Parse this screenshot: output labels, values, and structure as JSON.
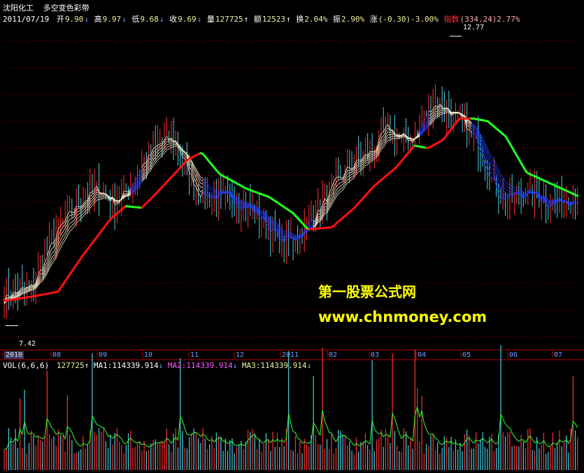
{
  "header": {
    "stock_name": "沈阳化工",
    "indicator_name": "多空变色彩带",
    "date": "2011/07/19",
    "open_label": "开",
    "open": "9.90",
    "high_label": "高",
    "high": "9.97",
    "low_label": "低",
    "low": "9.68",
    "close_label": "收",
    "close": "9.69",
    "volume_label": "量",
    "volume": "127725",
    "amount_label": "额",
    "amount": "12523",
    "turnover_label": "换",
    "turnover": "2.04%",
    "amplitude_label": "振",
    "amplitude": "2.90%",
    "change_label": "涨",
    "change": "(-0.30)-3.00%",
    "index_label": "指数",
    "index_value": "(334.24)2.77%"
  },
  "volume_panel": {
    "title": "VOL(6,6,6)",
    "volume": "127725",
    "ma1_label": "MA1:",
    "ma1": "114339.914",
    "ma2_label": "MA2:",
    "ma2": "114339.914",
    "ma3_label": "MA3:",
    "ma3": "114339.914"
  },
  "watermark": {
    "line1": "第一股票公式网",
    "line2": "www.chnmoney.com"
  },
  "colors": {
    "up": "#ff3030",
    "down": "#46d2e6",
    "bull_ribbon": "#ffffff",
    "bear_ribbon": "#1e3cff",
    "ma_up": "#ff1010",
    "ma_down": "#20ff20",
    "vol_ma": "#30ff30",
    "grid": "#8a0000"
  },
  "chart_data": [
    {
      "type": "candlestick-ribbon",
      "y_range": [
        7.0,
        13.0
      ],
      "x_tick_labels": [
        "2010",
        "08",
        "09",
        "10",
        "11",
        "12",
        "2011",
        "02",
        "03",
        "04",
        "05",
        "06",
        "07"
      ],
      "annotations": [
        {
          "text": "12.77",
          "meaning": "period high"
        },
        {
          "text": "7.42",
          "meaning": "period low"
        }
      ],
      "trend_line": [
        {
          "date": "2010-07-01",
          "price": 7.88
        },
        {
          "date": "2010-07-20",
          "price": 7.96
        },
        {
          "date": "2010-08-06",
          "price": 8.05
        },
        {
          "date": "2010-08-22",
          "price": 8.7
        },
        {
          "date": "2010-09-10",
          "price": 9.39
        },
        {
          "date": "2010-09-20",
          "price": 9.63
        },
        {
          "date": "2010-10-01",
          "price": 9.6
        },
        {
          "date": "2010-10-10",
          "price": 9.85
        },
        {
          "date": "2010-11-01",
          "price": 10.5
        },
        {
          "date": "2010-11-10",
          "price": 10.62
        },
        {
          "date": "2010-11-22",
          "price": 10.22
        },
        {
          "date": "2010-12-10",
          "price": 9.95
        },
        {
          "date": "2010-12-25",
          "price": 9.8
        },
        {
          "date": "2011-01-10",
          "price": 9.5
        },
        {
          "date": "2011-01-20",
          "price": 9.2
        },
        {
          "date": "2011-02-05",
          "price": 9.24
        },
        {
          "date": "2011-02-20",
          "price": 9.6
        },
        {
          "date": "2011-03-05",
          "price": 10.0
        },
        {
          "date": "2011-03-20",
          "price": 10.35
        },
        {
          "date": "2011-04-01",
          "price": 10.75
        },
        {
          "date": "2011-04-10",
          "price": 10.7
        },
        {
          "date": "2011-04-20",
          "price": 10.85
        },
        {
          "date": "2011-05-01",
          "price": 11.25
        },
        {
          "date": "2011-05-10",
          "price": 11.25
        },
        {
          "date": "2011-05-20",
          "price": 11.2
        },
        {
          "date": "2011-06-01",
          "price": 10.92
        },
        {
          "date": "2011-06-15",
          "price": 10.25
        },
        {
          "date": "2011-07-19",
          "price": 9.82
        }
      ],
      "daily_bars": {
        "date_range": [
          "2010-07-01",
          "2011-07-19"
        ],
        "bar_count": 255,
        "price_range": [
          7.42,
          12.77
        ],
        "last_bar": {
          "date": "2011-07-19",
          "open": 9.9,
          "high": 9.97,
          "low": 9.68,
          "close": 9.69
        }
      }
    },
    {
      "type": "bar",
      "title": "VOL(6,6,6)",
      "last_volume": 127725,
      "series": [
        {
          "name": "MA1",
          "last": 114339.914
        },
        {
          "name": "MA2",
          "last": 114339.914
        },
        {
          "name": "MA3",
          "last": 114339.914
        }
      ],
      "daily_volume": {
        "bar_count": 255,
        "level": "average around 114000, peaks about 3 times the average"
      }
    }
  ]
}
